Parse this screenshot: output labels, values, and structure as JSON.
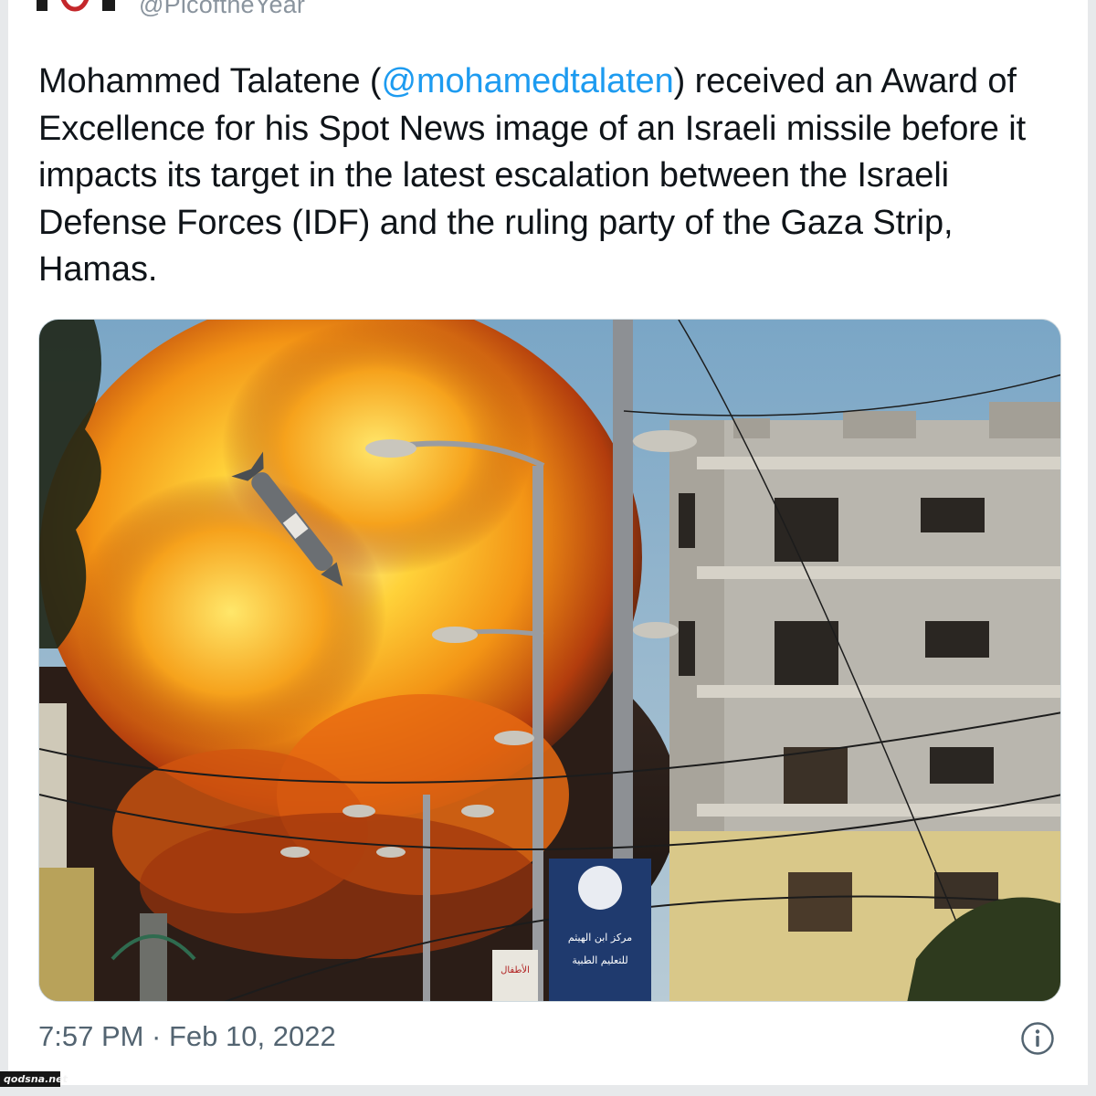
{
  "account": {
    "handle": "@PicoftheYear"
  },
  "tweet": {
    "text_before": "Mohammed Talatene (",
    "mention": "@mohamedtalaten",
    "text_after": ") received an Award of Excellence for his Spot News image of an Israeli missile before it impacts its target in the latest escalation between the Israeli Defense Forces (IDF) and the ruling party of the Gaza Strip, Hamas.",
    "timestamp": "7:57 PM · Feb 10, 2022"
  },
  "photo": {
    "description_icon": "explosion-photo",
    "sign_text": {
      "line1": "مركز ابن الهيثم",
      "line2": "للتعليم الطبية",
      "line3": "الأطفال"
    }
  },
  "icons": {
    "info": "info-icon",
    "logo": "account-logo"
  },
  "watermark": {
    "text": "qodsna.net"
  },
  "colors": {
    "link": "#1d9bf0",
    "text": "#0f1419",
    "meta": "#536471"
  }
}
